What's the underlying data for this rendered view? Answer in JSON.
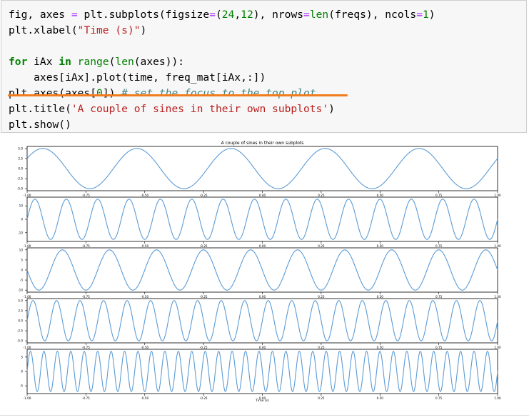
{
  "code": {
    "lines": [
      [
        [
          "t",
          "fig, axes "
        ],
        [
          "o",
          "="
        ],
        [
          "t",
          " plt.subplots(figsize"
        ],
        [
          "o",
          "="
        ],
        [
          "t",
          "("
        ],
        [
          "n",
          "24"
        ],
        [
          "t",
          ","
        ],
        [
          "n",
          "12"
        ],
        [
          "t",
          "), nrows"
        ],
        [
          "o",
          "="
        ],
        [
          "b",
          "len"
        ],
        [
          "t",
          "(freqs), ncols"
        ],
        [
          "o",
          "="
        ],
        [
          "n",
          "1"
        ],
        [
          "t",
          ")"
        ]
      ],
      [
        [
          "t",
          "plt.xlabel("
        ],
        [
          "s",
          "\"Time (s)\""
        ],
        [
          "t",
          ")"
        ]
      ],
      [],
      [
        [
          "k",
          "for"
        ],
        [
          "t",
          " iAx "
        ],
        [
          "k",
          "in"
        ],
        [
          "t",
          " "
        ],
        [
          "b",
          "range"
        ],
        [
          "t",
          "("
        ],
        [
          "b",
          "len"
        ],
        [
          "t",
          "(axes)):"
        ]
      ],
      [
        [
          "t",
          "    axes[iAx].plot(time, freq_mat[iAx,:])"
        ]
      ],
      [
        [
          "t",
          "plt.axes(axes["
        ],
        [
          "n",
          "0"
        ],
        [
          "t",
          "]) "
        ],
        [
          "c",
          "# set the focus to the top plot"
        ]
      ],
      [
        [
          "t",
          "plt.title("
        ],
        [
          "s",
          "'A couple of sines in their own subplots'"
        ],
        [
          "t",
          ")"
        ]
      ],
      [
        [
          "t",
          "plt.show()"
        ]
      ]
    ]
  },
  "colors": {
    "line": "#5b9bd5",
    "annotation_underline": "#f07c1e",
    "cell_bg": "#f7f7f7"
  },
  "chart_data": {
    "type": "line",
    "title": "A couple of sines in their own subplots",
    "xlabel": "Time (s)",
    "xlim": [
      -1.0,
      1.0
    ],
    "x_tick_labels": [
      "-1.00",
      "-0.75",
      "-0.50",
      "-0.25",
      "0.00",
      "0.25",
      "0.50",
      "0.75",
      "1.00"
    ],
    "grid": false,
    "subplots": [
      {
        "cycles": 5,
        "amplitude": 5,
        "phase_deg": 30,
        "ylim": [
          -5.5,
          5.5
        ],
        "y_tick_values": [
          5,
          2.5,
          0,
          -2.5,
          -5
        ],
        "y_tick_labels": [
          "5.0",
          "2.5",
          "0.0",
          "-2.5",
          "-5.0"
        ]
      },
      {
        "cycles": 15,
        "amplitude": 15,
        "phase_deg": 0,
        "ylim": [
          -16.5,
          16.5
        ],
        "y_tick_values": [
          10,
          0,
          -10
        ],
        "y_tick_labels": [
          "10",
          "0",
          "-10"
        ]
      },
      {
        "cycles": 10,
        "amplitude": 10,
        "phase_deg": 180,
        "ylim": [
          -11,
          11
        ],
        "y_tick_values": [
          10,
          5,
          0,
          -5,
          -10
        ],
        "y_tick_labels": [
          "10",
          "5",
          "0",
          "-5",
          "-10"
        ]
      },
      {
        "cycles": 20,
        "amplitude": 5,
        "phase_deg": 0,
        "ylim": [
          -5.5,
          5.5
        ],
        "y_tick_values": [
          5,
          2.5,
          0,
          -2.5,
          -5
        ],
        "y_tick_labels": [
          "5.0",
          "2.5",
          "0.0",
          "-2.5",
          "-5.0"
        ]
      },
      {
        "cycles": 35,
        "amplitude": 7,
        "phase_deg": 0,
        "ylim": [
          -7.7,
          7.7
        ],
        "y_tick_values": [
          5,
          0,
          -5
        ],
        "y_tick_labels": [
          "5",
          "0",
          "-5"
        ]
      }
    ]
  }
}
